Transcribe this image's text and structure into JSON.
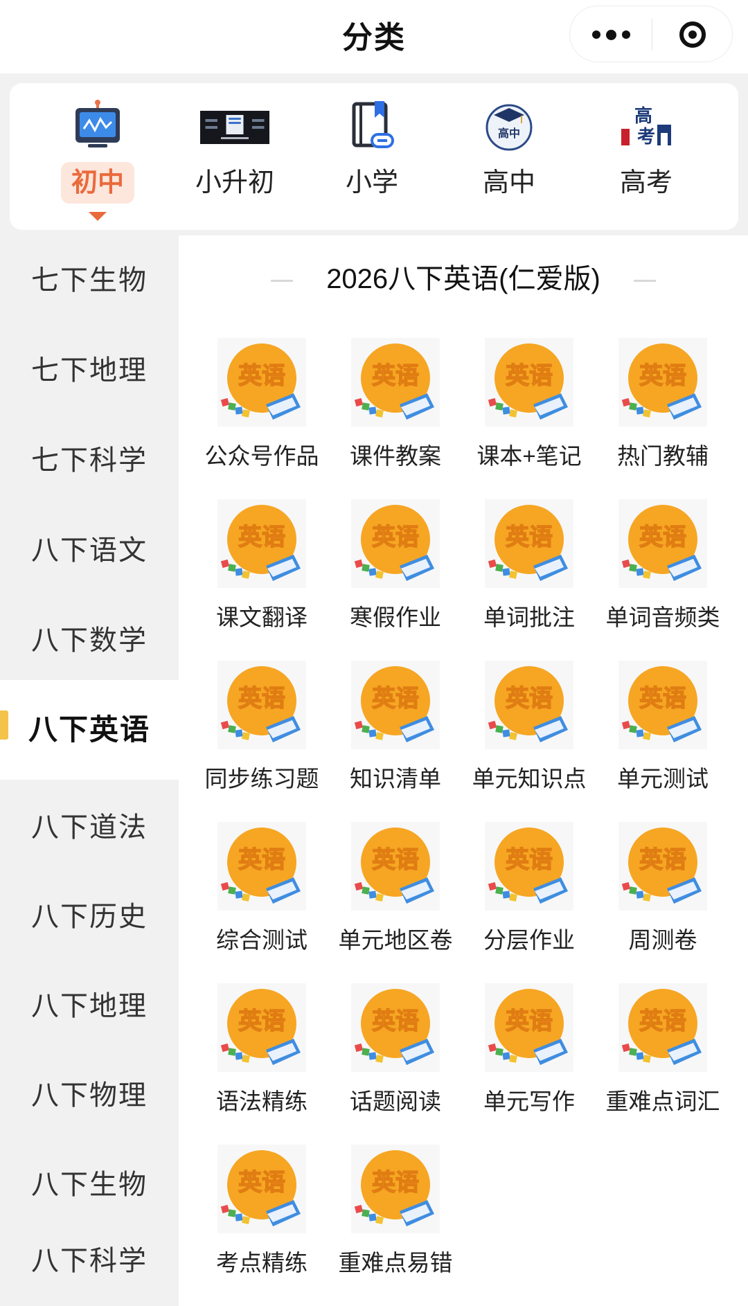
{
  "header": {
    "title": "分类",
    "more_icon": "more-dots-icon",
    "close_icon": "miniprogram-close-icon"
  },
  "topnav": {
    "items": [
      {
        "label": "初中",
        "icon": "monitor-wave-icon",
        "active": true
      },
      {
        "label": "小升初",
        "icon": "promo-banner-icon",
        "active": false
      },
      {
        "label": "小学",
        "icon": "bookmark-link-icon",
        "active": false
      },
      {
        "label": "高中",
        "icon": "graduation-cap-badge-icon",
        "active": false
      },
      {
        "label": "高考",
        "icon": "gaokao-gate-icon",
        "active": false
      }
    ],
    "accent_color": "#ea6a3c"
  },
  "sidebar": {
    "items": [
      {
        "label": "七下生物"
      },
      {
        "label": "七下地理"
      },
      {
        "label": "七下科学"
      },
      {
        "label": "八下语文"
      },
      {
        "label": "八下数学"
      },
      {
        "label": "八下英语",
        "active": true
      },
      {
        "label": "八下道法"
      },
      {
        "label": "八下历史"
      },
      {
        "label": "八下地理"
      },
      {
        "label": "八下物理"
      },
      {
        "label": "八下生物"
      },
      {
        "label": "八下科学"
      }
    ],
    "active_indicator_color": "#f3c34a"
  },
  "main": {
    "section_title": "2026八下英语(仁爱版)",
    "icon_badge_text": "英语",
    "icon_name": "english-book-icon",
    "items": [
      {
        "label": "公众号作品"
      },
      {
        "label": "课件教案"
      },
      {
        "label": "课本+笔记"
      },
      {
        "label": "热门教辅"
      },
      {
        "label": "课文翻译"
      },
      {
        "label": "寒假作业"
      },
      {
        "label": "单词批注"
      },
      {
        "label": "单词音频类"
      },
      {
        "label": "同步练习题"
      },
      {
        "label": "知识清单"
      },
      {
        "label": "单元知识点"
      },
      {
        "label": "单元测试"
      },
      {
        "label": "综合测试"
      },
      {
        "label": "单元地区卷"
      },
      {
        "label": "分层作业"
      },
      {
        "label": "周测卷"
      },
      {
        "label": "语法精练"
      },
      {
        "label": "话题阅读"
      },
      {
        "label": "单元写作"
      },
      {
        "label": "重难点词汇"
      },
      {
        "label": "考点精练"
      },
      {
        "label": "重难点易错"
      }
    ]
  },
  "colors": {
    "badge_orange": "#f6a623",
    "book_blue": "#3f8de0"
  }
}
